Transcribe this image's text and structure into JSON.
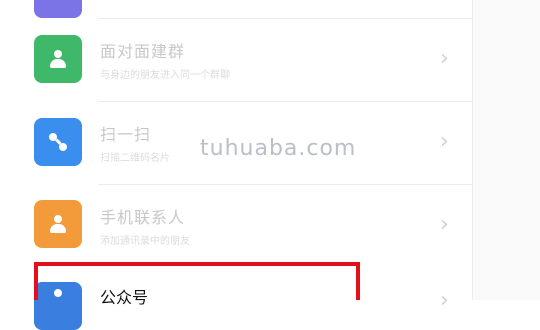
{
  "menu": {
    "rows": [
      {
        "icon": "people-nearby-icon",
        "color": "#3fb86a",
        "title": "面对面建群",
        "subtitle": "与身边的朋友进入同一个群聊"
      },
      {
        "icon": "scan-icon",
        "color": "#3a8eed",
        "title": "扫一扫",
        "subtitle": "扫描二维码名片"
      },
      {
        "icon": "contact-icon",
        "color": "#f39b3a",
        "title": "手机联系人",
        "subtitle": "添加通讯录中的朋友"
      },
      {
        "icon": "official-account-icon",
        "color": "#3a7fe0",
        "title": "公众号",
        "subtitle": ""
      }
    ],
    "chevron": "›"
  },
  "watermark": "tuhuaba.com",
  "colors": {
    "highlight": "#e3101a"
  }
}
